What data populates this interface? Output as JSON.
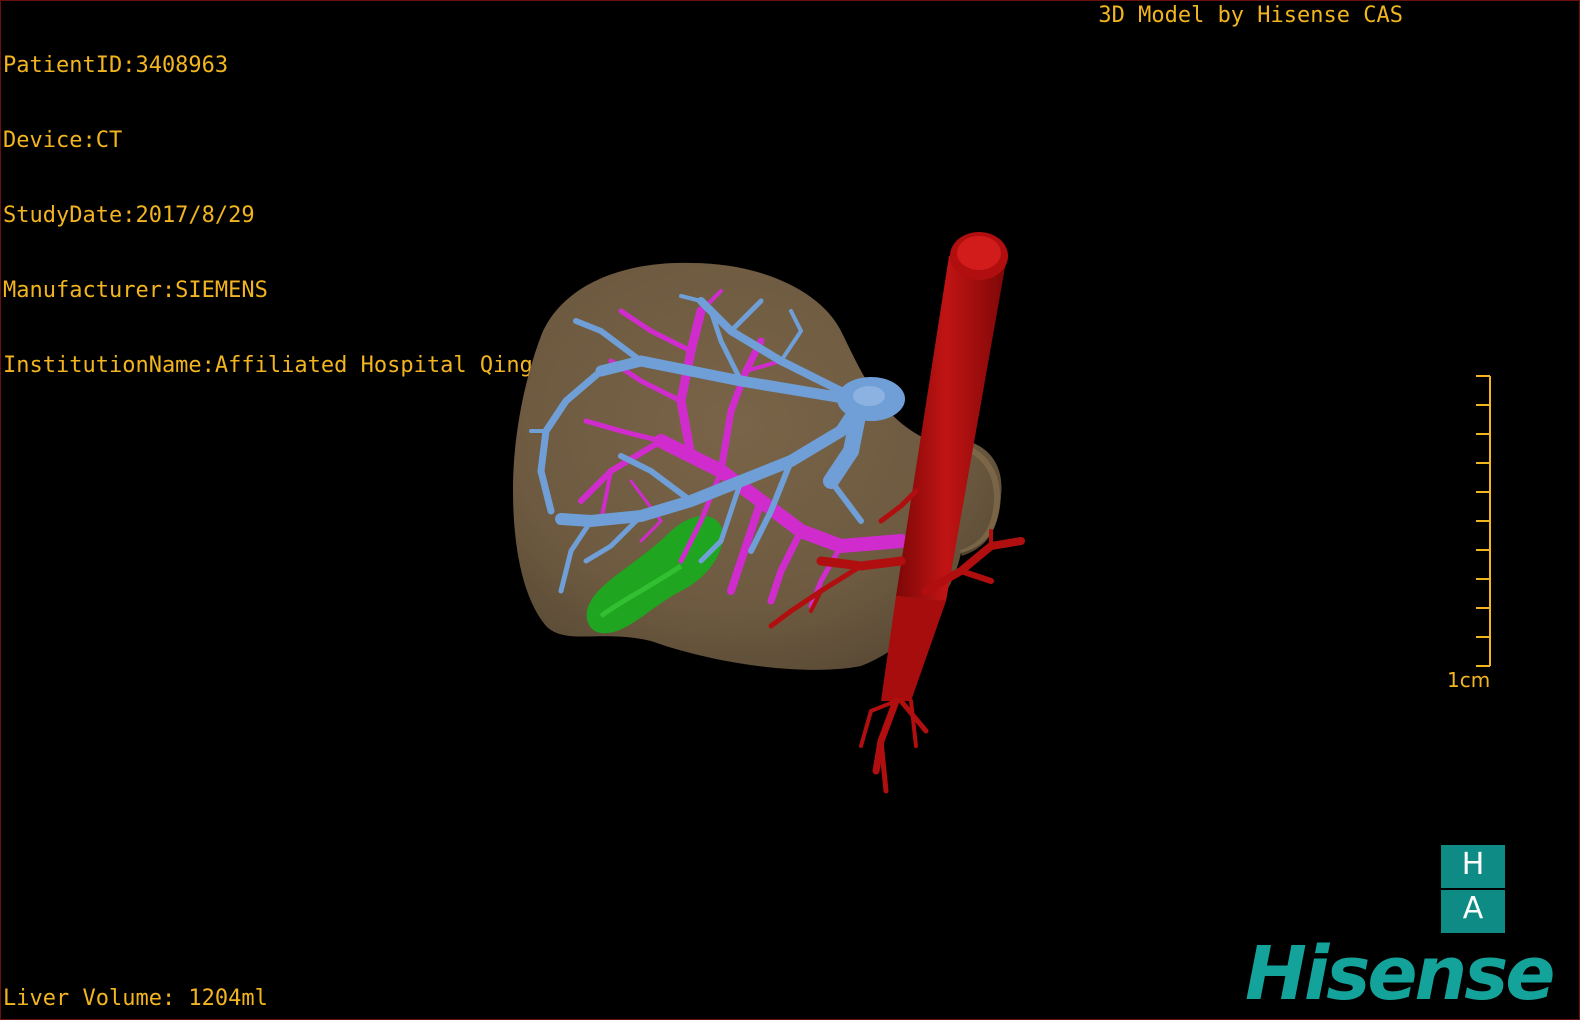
{
  "overlay": {
    "patient_id": "PatientID:3408963",
    "device": "Device:CT",
    "study_date": "StudyDate:2017/8/29",
    "manufacturer": "Manufacturer:SIEMENS",
    "institution": "InstitutionName:Affiliated Hospital Qingdao University-C",
    "credit": "3D Model by Hisense CAS",
    "liver_volume": "Liver Volume: 1204ml"
  },
  "scale_bar": {
    "label": "1cm"
  },
  "orientation": {
    "top": "H",
    "bottom": "A"
  },
  "logo": {
    "text": "Hisense"
  },
  "colors": {
    "overlay_text": "#f2b51f",
    "liver": "#8a7150",
    "hepatic_vein": "#6f9fd6",
    "portal_vein": "#d02ccd",
    "artery_aorta": "#b10f0f",
    "gallbladder": "#1fa51f",
    "logo": "#14a39b",
    "orientation_box": "#0f8b86"
  }
}
